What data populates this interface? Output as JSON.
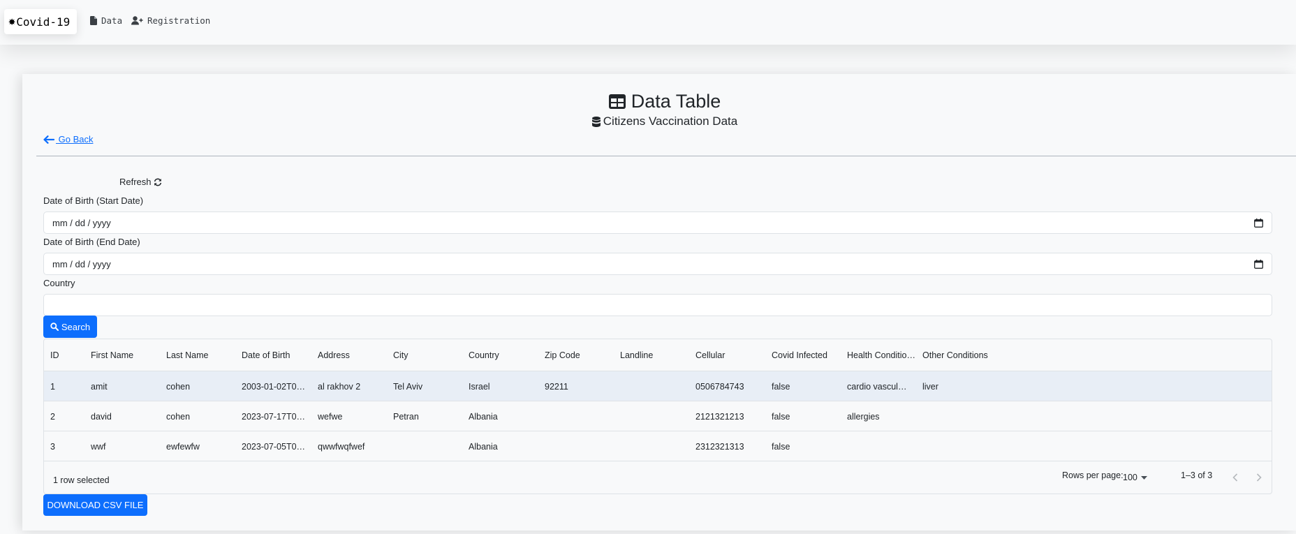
{
  "navbar": {
    "brand_label": "Covid-19",
    "brand_icon": "gear-icon",
    "links": [
      {
        "label": "Data",
        "icon": "file-icon"
      },
      {
        "label": "Registration",
        "icon": "user-plus-icon"
      }
    ]
  },
  "page": {
    "title": "Data Table",
    "title_icon": "table-icon",
    "subtitle": "Citizens Vaccination Data",
    "subtitle_icon": "database-icon",
    "go_back_label": " Go Back",
    "refresh_label": "Refresh"
  },
  "filters": {
    "dob_start_label": "Date of Birth (Start Date)",
    "dob_start_value": "mm / dd / yyyy",
    "dob_end_label": "Date of Birth (End Date)",
    "dob_end_value": "mm / dd / yyyy",
    "country_label": "Country",
    "country_value": "",
    "search_label": "Search"
  },
  "grid": {
    "columns": [
      "ID",
      "First Name",
      "Last Name",
      "Date of Birth",
      "Address",
      "City",
      "Country",
      "Zip Code",
      "Landline",
      "Cellular",
      "Covid Infected",
      "Health Conditio…",
      "Other Conditions"
    ],
    "rows": [
      {
        "cells": [
          "1",
          "amit",
          "cohen",
          "2003-01-02T0…",
          "al rakhov 2",
          "Tel Aviv",
          "Israel",
          "92211",
          "",
          "0506784743",
          "false",
          "cardio vascul…",
          "liver"
        ]
      },
      {
        "cells": [
          "2",
          "david",
          "cohen",
          "2023-07-17T0…",
          "wefwe",
          "Petran",
          "Albania",
          "",
          "",
          "2121321213",
          "false",
          "allergies",
          ""
        ]
      },
      {
        "cells": [
          "3",
          "wwf",
          "ewfewfw",
          "2023-07-05T0…",
          "qwwfwqfwef",
          "",
          "Albania",
          "",
          "",
          "2312321313",
          "false",
          "",
          ""
        ]
      }
    ],
    "selected_row_index": 0,
    "footer": {
      "selected_text": "1 row selected",
      "rows_per_page_label": "Rows per page:",
      "rows_per_page_value": "100",
      "range_text": "1–3 of 3"
    }
  },
  "download_label": "DOWNLOAD CSV FILE",
  "colors": {
    "primary": "#0d6efd",
    "background": "#f8f9fa",
    "selected_row": "#e8eef6"
  }
}
